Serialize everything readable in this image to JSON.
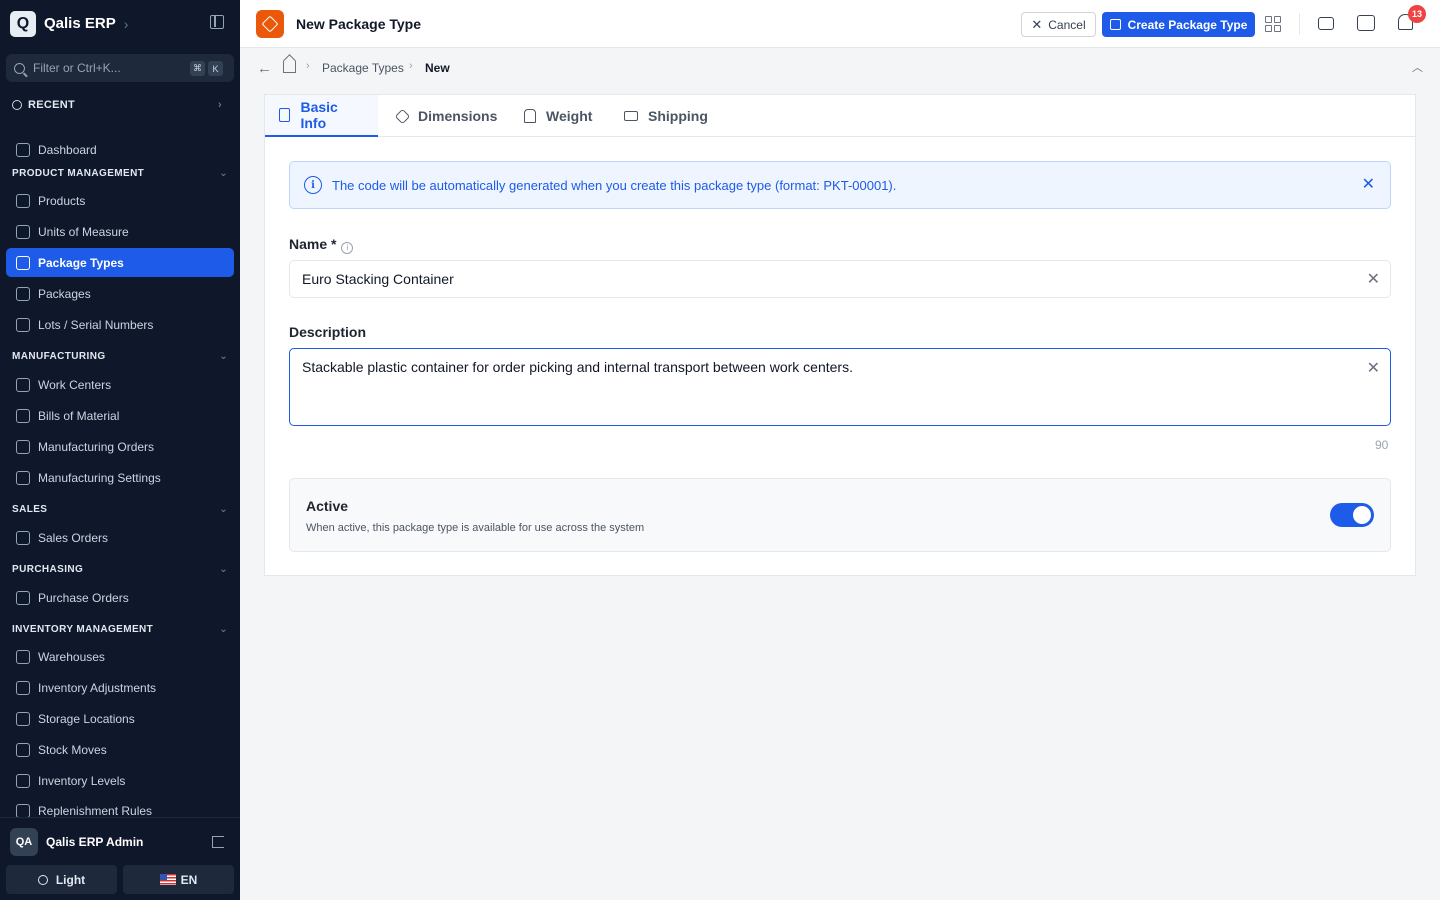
{
  "app": {
    "logo_letter": "Q",
    "name": "Qalis ERP"
  },
  "filter": {
    "placeholder": "Filter or Ctrl+K...",
    "kbd1": "⌘",
    "kbd2": "K"
  },
  "sidebar": {
    "recent_label": "RECENT",
    "dashboard": "Dashboard",
    "sections": {
      "product_management": "PRODUCT MANAGEMENT",
      "manufacturing": "MANUFACTURING",
      "sales": "SALES",
      "purchasing": "PURCHASING",
      "inventory_management": "INVENTORY MANAGEMENT"
    },
    "items": {
      "products": "Products",
      "units_of_measure": "Units of Measure",
      "package_types": "Package Types",
      "packages": "Packages",
      "lots_serial": "Lots / Serial Numbers",
      "work_centers": "Work Centers",
      "bills_of_material": "Bills of Material",
      "manufacturing_orders": "Manufacturing Orders",
      "manufacturing_settings": "Manufacturing Settings",
      "sales_orders": "Sales Orders",
      "purchase_orders": "Purchase Orders",
      "warehouses": "Warehouses",
      "inventory_adjustments": "Inventory Adjustments",
      "storage_locations": "Storage Locations",
      "stock_moves": "Stock Moves",
      "inventory_levels": "Inventory Levels",
      "replenishment_rules": "Replenishment Rules"
    },
    "user": {
      "initials": "QA",
      "name": "Qalis ERP Admin"
    },
    "theme_label": "Light",
    "lang_label": "EN"
  },
  "header": {
    "title": "New Package Type",
    "cancel_label": "Cancel",
    "create_label": "Create Package Type",
    "notification_count": "13"
  },
  "breadcrumb": {
    "parent": "Package Types",
    "current": "New"
  },
  "tabs": [
    "Basic Info",
    "Dimensions",
    "Weight",
    "Shipping"
  ],
  "form": {
    "info_text": "The code will be automatically generated when you create this package type (format: PKT-00001).",
    "name_label": "Name *",
    "name_value": "Euro Stacking Container",
    "description_label": "Description",
    "description_value": "Stackable plastic container for order picking and internal transport between work centers.",
    "char_count": "90",
    "active_title": "Active",
    "active_desc": "When active, this package type is available for use across the system",
    "active_on": true
  },
  "colors": {
    "accent": "#1d5be8",
    "sidebar_bg": "#0f172a",
    "page_icon": "#ea580c",
    "badge": "#ef4444"
  }
}
